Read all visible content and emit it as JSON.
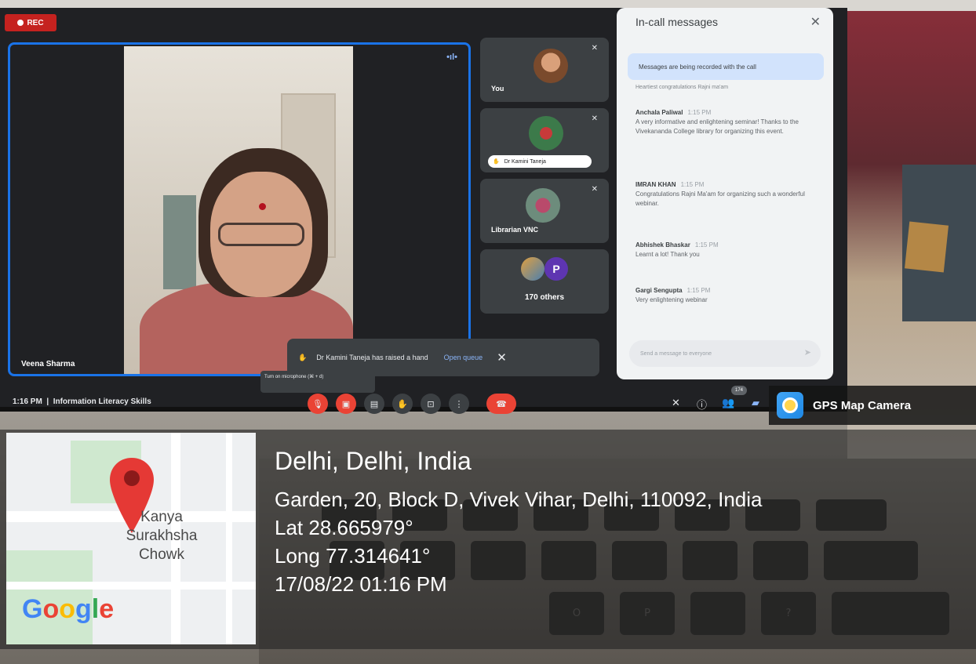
{
  "meet": {
    "rec_label": "REC",
    "speaker_name": "Veena Sharma",
    "tiles": [
      {
        "label": "You"
      },
      {
        "label": "Dr Kamini Taneja"
      },
      {
        "label": "Librarian VNC"
      },
      {
        "label": "170 others",
        "avatar_letter": "P"
      }
    ],
    "notification": {
      "text": "Dr Kamini Taneja has raised a hand",
      "action": "Open queue"
    },
    "tooltip": "Turn on microphone (⌘ + d)",
    "time": "1:16 PM",
    "meeting_title": "Information Literacy Skills",
    "people_count": "174"
  },
  "chat": {
    "title": "In-call messages",
    "banner": "Messages are being recorded with the call",
    "cut_off_text": "Heartiest congratulations Rajni ma'am",
    "messages": [
      {
        "sender": "Anchala Paliwal",
        "time": "1:15 PM",
        "text": "A very informative and enlightening seminar! Thanks to the Vivekananda College library for organizing this event."
      },
      {
        "sender": "IMRAN KHAN",
        "time": "1:15 PM",
        "text": "Congratulations Rajni Ma'am for organizing such a wonderful webinar."
      },
      {
        "sender": "Abhishek Bhaskar",
        "time": "1:15 PM",
        "text": "Learnt a lot! Thank you"
      },
      {
        "sender": "Gargi Sengupta",
        "time": "1:15 PM",
        "text": "Very enlightening webinar"
      }
    ],
    "input_placeholder": "Send a message to everyone"
  },
  "gps": {
    "brand": "GPS Map Camera",
    "city": "Delhi, Delhi, India",
    "address": "Garden, 20, Block D, Vivek Vihar, Delhi, 110092, India",
    "lat": "Lat 28.665979°",
    "long": "Long 77.314641°",
    "datetime": "17/08/22 01:16 PM",
    "map_place_lines": [
      "Kanya",
      "Surakhsha",
      "Chowk"
    ],
    "map_logo": "Google"
  },
  "keyboard_keys": [
    "O",
    "P",
    "?"
  ],
  "colors": {
    "accent": "#1a73e8",
    "danger": "#ea4335",
    "pin": "#e53935",
    "google": [
      "#4285f4",
      "#ea4335",
      "#fbbc05",
      "#4285f4",
      "#34a853",
      "#ea4335"
    ]
  },
  "icons": [
    "record-icon",
    "speaking-icon",
    "mute-icon",
    "raised-hand-icon",
    "close-icon",
    "mic-off-icon",
    "camera-off-icon",
    "captions-icon",
    "hand-icon",
    "present-icon",
    "more-icon",
    "hang-up-icon",
    "info-icon",
    "people-icon",
    "chat-icon",
    "send-icon",
    "map-pin-icon",
    "gps-camera-logo"
  ]
}
